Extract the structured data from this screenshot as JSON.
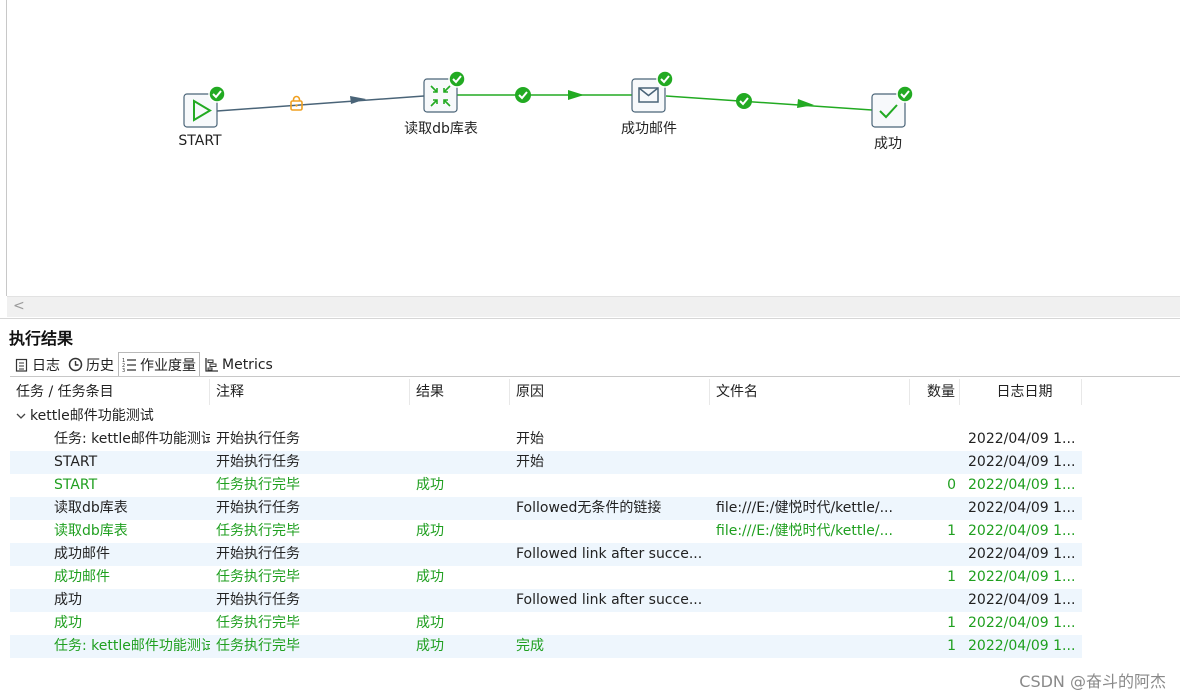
{
  "canvas": {
    "nodes": [
      {
        "id": "start",
        "label": "START",
        "icon": "play-icon"
      },
      {
        "id": "read",
        "label": "读取db库表",
        "icon": "table-input-icon"
      },
      {
        "id": "mail",
        "label": "成功邮件",
        "icon": "mail-icon"
      },
      {
        "id": "success",
        "label": "成功",
        "icon": "checkmark-icon"
      }
    ],
    "scroll_arrow": "<"
  },
  "results": {
    "title": "执行结果",
    "tabs": [
      {
        "label": "日志",
        "icon": "log-icon"
      },
      {
        "label": "历史",
        "icon": "history-icon"
      },
      {
        "label": "作业度量",
        "icon": "job-metrics-icon",
        "active": true
      },
      {
        "label": "Metrics",
        "icon": "metrics-icon"
      }
    ],
    "columns": [
      "任务 / 任务条目",
      "注释",
      "结果",
      "原因",
      "文件名",
      "数量",
      "日志日期"
    ],
    "group": "kettle邮件功能测试",
    "rows": [
      {
        "entry": "任务: kettle邮件功能测试",
        "comment": "开始执行任务",
        "result": "",
        "reason": "开始",
        "file": "",
        "count": "",
        "date": "2022/04/09 1...",
        "green": false
      },
      {
        "entry": "START",
        "comment": "开始执行任务",
        "result": "",
        "reason": "开始",
        "file": "",
        "count": "",
        "date": "2022/04/09 1...",
        "green": false
      },
      {
        "entry": "START",
        "comment": "任务执行完毕",
        "result": "成功",
        "reason": "",
        "file": "",
        "count": "0",
        "date": "2022/04/09 1...",
        "green": true
      },
      {
        "entry": "读取db库表",
        "comment": "开始执行任务",
        "result": "",
        "reason": "Followed无条件的链接",
        "file": "file:///E:/健悦时代/kettle/...",
        "count": "",
        "date": "2022/04/09 1...",
        "green": false
      },
      {
        "entry": "读取db库表",
        "comment": "任务执行完毕",
        "result": "成功",
        "reason": "",
        "file": "file:///E:/健悦时代/kettle/...",
        "count": "1",
        "date": "2022/04/09 1...",
        "green": true
      },
      {
        "entry": "成功邮件",
        "comment": "开始执行任务",
        "result": "",
        "reason": "Followed link after succe...",
        "file": "",
        "count": "",
        "date": "2022/04/09 1...",
        "green": false
      },
      {
        "entry": "成功邮件",
        "comment": "任务执行完毕",
        "result": "成功",
        "reason": "",
        "file": "",
        "count": "1",
        "date": "2022/04/09 1...",
        "green": true
      },
      {
        "entry": "成功",
        "comment": "开始执行任务",
        "result": "",
        "reason": "Followed link after succe...",
        "file": "",
        "count": "",
        "date": "2022/04/09 1...",
        "green": false
      },
      {
        "entry": "成功",
        "comment": "任务执行完毕",
        "result": "成功",
        "reason": "",
        "file": "",
        "count": "1",
        "date": "2022/04/09 1...",
        "green": true
      },
      {
        "entry": "任务: kettle邮件功能测试",
        "comment": "任务执行完毕",
        "result": "成功",
        "reason": "完成",
        "file": "",
        "count": "1",
        "date": "2022/04/09 1...",
        "green": true
      }
    ]
  },
  "watermark": "CSDN @奋斗的阿杰",
  "colors": {
    "success_green": "#1f9f1f",
    "hop_green": "#22aa22",
    "hop_dark": "#4a6478",
    "lock_orange": "#f0a020",
    "row_alt": "#eef6fd"
  }
}
